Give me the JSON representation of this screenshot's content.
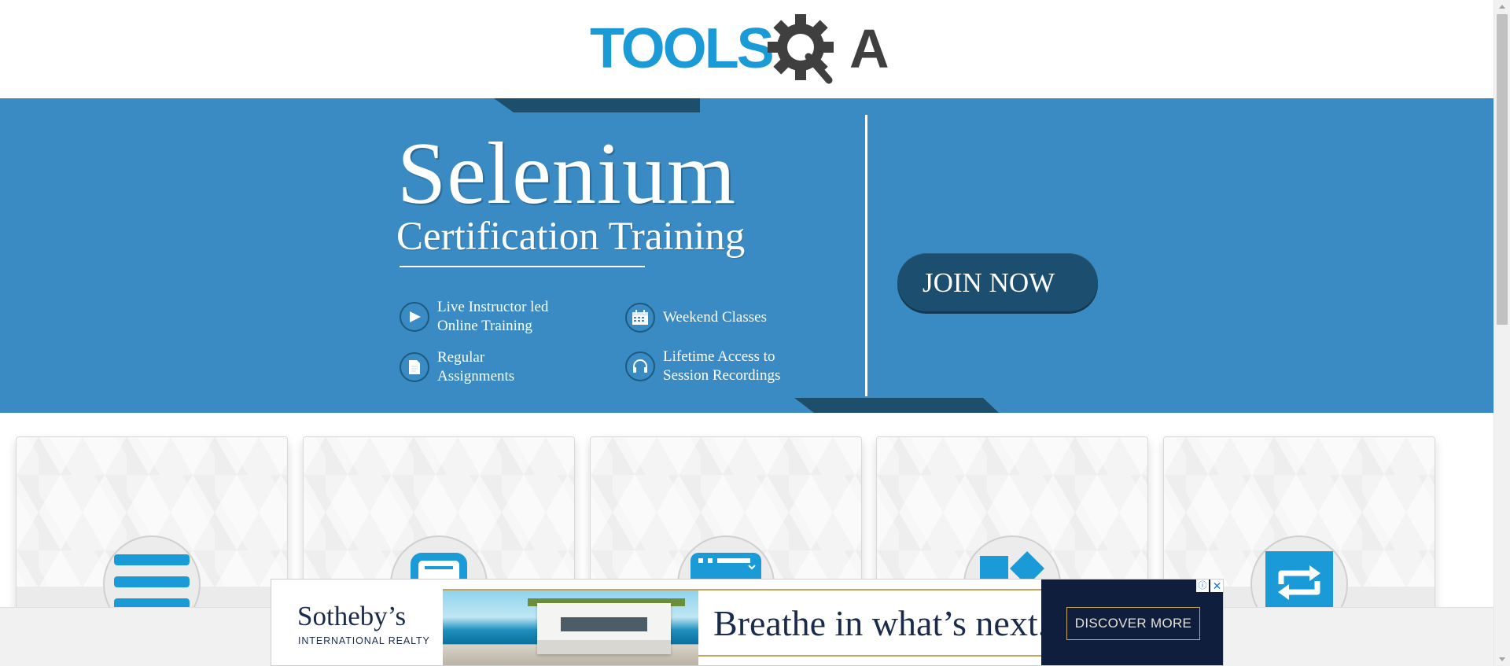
{
  "header": {
    "logo": {
      "text_tools": "TOOLS",
      "text_qa": "QA",
      "colors": {
        "tools": "#1a9bd7",
        "gear": "#3f3f3f"
      }
    }
  },
  "banner": {
    "title": "Selenium",
    "subtitle": "Certification Training",
    "features": [
      {
        "icon": "play-icon",
        "label": "Live Instructor led\nOnline Training"
      },
      {
        "icon": "calendar-icon",
        "label": "Weekend Classes"
      },
      {
        "icon": "document-icon",
        "label": "Regular\nAssignments"
      },
      {
        "icon": "headphones-icon",
        "label": "Lifetime Access to\nSession Recordings"
      }
    ],
    "cta_label": "JOIN NOW",
    "colors": {
      "background": "#3a8bc4",
      "button": "#1c4f6f",
      "accent_strip": "#1d4e6b"
    }
  },
  "cards": [
    {
      "icon": "menu-lines-icon"
    },
    {
      "icon": "form-icon"
    },
    {
      "icon": "window-icon"
    },
    {
      "icon": "widgets-icon"
    },
    {
      "icon": "interactions-icon"
    }
  ],
  "ad": {
    "brand_name": "Sotheby’s",
    "brand_sub": "INTERNATIONAL REALTY",
    "tagline": "Breathe in what’s next.",
    "cta_label": "DISCOVER MORE",
    "info_icon": "info-icon",
    "close_icon": "close-icon",
    "colors": {
      "navy": "#0f1e3c",
      "gold": "#c7a55c"
    }
  }
}
